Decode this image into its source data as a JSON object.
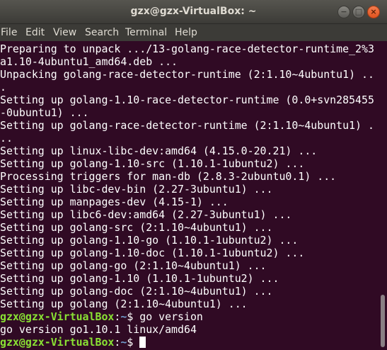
{
  "window": {
    "title": "gzx@gzx-VirtualBox: ~",
    "minimize_glyph": "−",
    "maximize_glyph": "□",
    "close_glyph": "×"
  },
  "menu": {
    "items": [
      "File",
      "Edit",
      "View",
      "Search",
      "Terminal",
      "Help"
    ]
  },
  "terminal": {
    "lines": [
      "Preparing to unpack .../13-golang-race-detector-runtime_2%3",
      "a1.10-4ubuntu1_amd64.deb ...",
      "Unpacking golang-race-detector-runtime (2:1.10~4ubuntu1) ..",
      ".",
      "Setting up golang-1.10-race-detector-runtime (0.0+svn285455",
      "-0ubuntu1) ...",
      "Setting up golang-race-detector-runtime (2:1.10~4ubuntu1) .",
      "..",
      "Setting up linux-libc-dev:amd64 (4.15.0-20.21) ...",
      "Setting up golang-1.10-src (1.10.1-1ubuntu2) ...",
      "Processing triggers for man-db (2.8.3-2ubuntu0.1) ...",
      "Setting up libc-dev-bin (2.27-3ubuntu1) ...",
      "Setting up manpages-dev (4.15-1) ...",
      "Setting up libc6-dev:amd64 (2.27-3ubuntu1) ...",
      "Setting up golang-src (2:1.10~4ubuntu1) ...",
      "Setting up golang-1.10-go (1.10.1-1ubuntu2) ...",
      "Setting up golang-1.10-doc (1.10.1-1ubuntu2) ...",
      "Setting up golang-go (2:1.10~4ubuntu1) ...",
      "Setting up golang-1.10 (1.10.1-1ubuntu2) ...",
      "Setting up golang-doc (2:1.10~4ubuntu1) ...",
      "Setting up golang (2:1.10~4ubuntu1) ..."
    ],
    "prompt": {
      "user_host": "gzx@gzx-VirtualBox",
      "separator": ":",
      "path": "~",
      "symbol": "$ "
    },
    "command_1": "go version",
    "output_1": "go version go1.10.1 linux/amd64",
    "command_2": ""
  },
  "colors": {
    "background": "#300a24",
    "titlebar": "#3c3b37",
    "prompt_user": "#8ae234",
    "prompt_path": "#729fcf",
    "text": "#ffffff"
  },
  "scrollbar": {
    "position_fraction": 1.0
  }
}
